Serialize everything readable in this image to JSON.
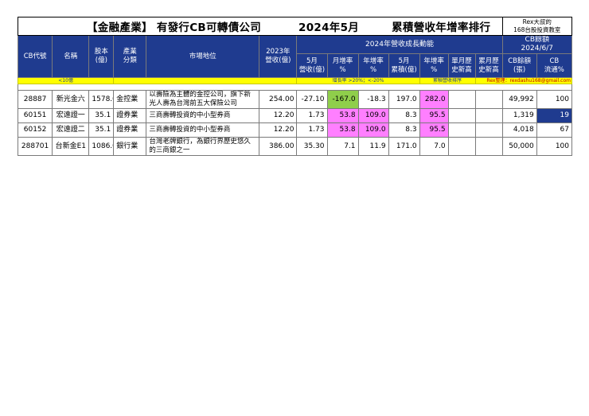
{
  "title": {
    "sector": "【金融產業】",
    "subject": "有發行CB可轉債公司",
    "period": "2024年5月",
    "ranking": "累積營收年增率排行"
  },
  "rex_box": {
    "line1": "Rex大叔的",
    "line2": "168台股投資教室"
  },
  "headers": {
    "code": "CB代號",
    "name": "名稱",
    "capital": "股本\n(億)",
    "industry": "產業\n分類",
    "position": "市場地位",
    "rev2023": "2023年\n營收(億)",
    "growth_group": "2024年營收成長動能",
    "may_rev": "5月\n營收(億)",
    "mom": "月增率\n%",
    "yoy": "年增率\n%",
    "may_cum": "5月\n累積(億)",
    "cum_yoy": "年增率\n%",
    "single_high": "單月歷\n史新高",
    "cum_high": "累月歷\n史新高",
    "cb_group": "CB餘額\n2024/6/7",
    "cb_bal": "CB餘額\n(張)",
    "cb_flow": "CB\n流通%"
  },
  "notes": {
    "capital": "<10億",
    "growth": "增長率 >20%；<-20%",
    "cum": "累積營收排序",
    "contact": "Rex整理：rexdashu168@gmail.com"
  },
  "rows": [
    {
      "code": "28887",
      "name": "新光金六",
      "capital": "1578.0",
      "industry": "金控業",
      "position": "以壽險為主體的金控公司，旗下新光人壽為台灣前五大保險公司",
      "rev2023": "254.00",
      "may_rev": "-27.10",
      "mom": "-167.0",
      "yoy": "-18.3",
      "may_cum": "197.0",
      "cum_yoy": "282.0",
      "single_high": "",
      "cum_high": "",
      "cb_bal": "49,992",
      "cb_flow": "100"
    },
    {
      "code": "60151",
      "name": "宏遠證一",
      "capital": "35.1",
      "industry": "證券業",
      "position": "三商壽轉投資的中小型券商",
      "rev2023": "12.20",
      "may_rev": "1.73",
      "mom": "53.8",
      "yoy": "109.0",
      "may_cum": "8.3",
      "cum_yoy": "95.5",
      "single_high": "",
      "cum_high": "",
      "cb_bal": "1,319",
      "cb_flow": "19"
    },
    {
      "code": "60152",
      "name": "宏遠證二",
      "capital": "35.1",
      "industry": "證券業",
      "position": "三商壽轉投資的中小型券商",
      "rev2023": "12.20",
      "may_rev": "1.73",
      "mom": "53.8",
      "yoy": "109.0",
      "may_cum": "8.3",
      "cum_yoy": "95.5",
      "single_high": "",
      "cum_high": "",
      "cb_bal": "4,018",
      "cb_flow": "67"
    },
    {
      "code": "288701",
      "name": "台新金E1",
      "capital": "1086.0",
      "industry": "銀行業",
      "position": "台灣老牌銀行，為銀行界歷史悠久的三商銀之一",
      "rev2023": "386.00",
      "may_rev": "35.30",
      "mom": "7.1",
      "yoy": "11.9",
      "may_cum": "171.0",
      "cum_yoy": "7.0",
      "single_high": "",
      "cum_high": "",
      "cb_bal": "50,000",
      "cb_flow": "100"
    }
  ],
  "colors": {
    "header_bg": "#1f3b8f",
    "note_bg": "#ffff00",
    "highlight_green": "#8fce4b",
    "highlight_pink": "#ff7fff",
    "highlight_navy": "#1f3b8f",
    "rex_box_bg": "#fffac8"
  }
}
